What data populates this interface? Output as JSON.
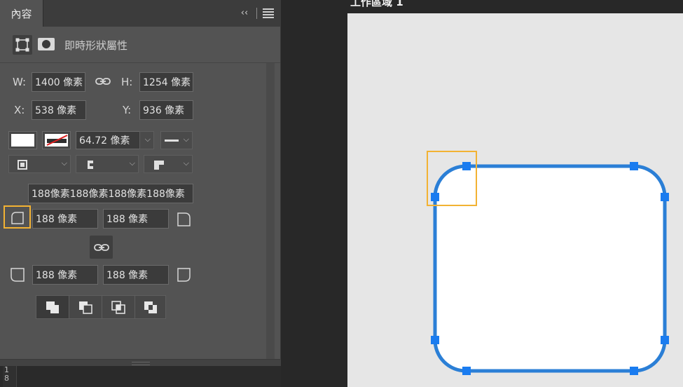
{
  "panel": {
    "tab_label": "內容",
    "collapse_glyph": "‹‹",
    "subtitle": "即時形狀屬性",
    "type_icons": [
      "shape-bounds-icon",
      "mask-icon"
    ]
  },
  "transform": {
    "w_label": "W:",
    "w_value": "1400 像素",
    "h_label": "H:",
    "h_value": "1254 像素",
    "x_label": "X:",
    "x_value": "538 像素",
    "y_label": "Y:",
    "y_value": "936 像素",
    "link_icon": "link-icon"
  },
  "appearance": {
    "fill_color": "#ffffff",
    "stroke_swatch": "no-stroke-swatch",
    "stroke_width": "64.72 像素",
    "stroke_style": "solid-line"
  },
  "corners": {
    "combined_value": "188像素188像素188像素188像素",
    "top_left": "188 像素",
    "top_right": "188 像素",
    "bottom_left": "188 像素",
    "bottom_right": "188 像素",
    "link_icon": "link-icon"
  },
  "path_ops": [
    "combine-shapes-icon",
    "subtract-front-icon",
    "intersect-icon",
    "exclude-overlap-icon"
  ],
  "canvas": {
    "artboard_label": "工作區域 1",
    "ruler_text": "1\n8",
    "shape_stroke_color": "#2b7fd6",
    "handle_color": "#1a7cf0",
    "highlight_color": "#f2b233",
    "artboard_bg": "#e6e6e6"
  }
}
